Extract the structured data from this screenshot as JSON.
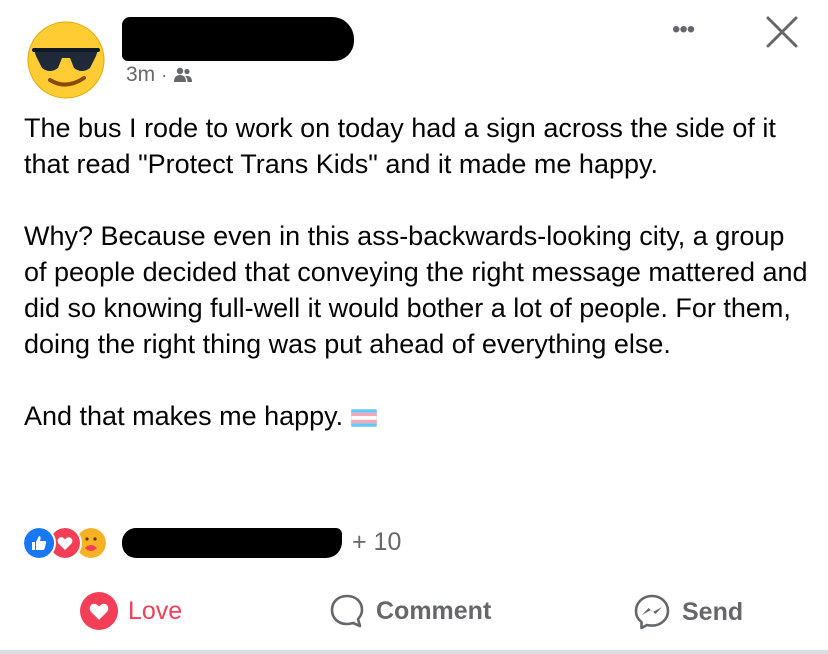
{
  "post": {
    "author_redacted": true,
    "time": "3m",
    "separator": "·",
    "audience_icon": "friends-icon",
    "paragraphs": [
      "The bus I rode to work on today had a sign across the side of it that read \"Protect Trans Kids\" and it made me happy.",
      "Why?  Because even in this ass-backwards-looking city, a group of people decided that conveying the right message mattered and did so knowing full-well it would bother a lot of people.  For them, doing the right thing was put ahead of everything else.",
      "And that makes me happy."
    ],
    "closing_emoji": "transgender-flag-icon"
  },
  "header": {
    "more_icon": "more-options-icon",
    "more_label": "•••",
    "close_icon": "close-icon"
  },
  "reactions": {
    "types": [
      "like-icon",
      "love-icon",
      "care-icon"
    ],
    "others_count": "+ 10"
  },
  "actions": {
    "love_label": "Love",
    "comment_label": "Comment",
    "send_label": "Send"
  },
  "colors": {
    "like_blue": "#1877f2",
    "love_red": "#f33e58",
    "care_yellow": "#f7b125",
    "secondary_text": "#65676b",
    "trans_blue": "#5bcefa",
    "trans_pink": "#f5a9b8"
  }
}
